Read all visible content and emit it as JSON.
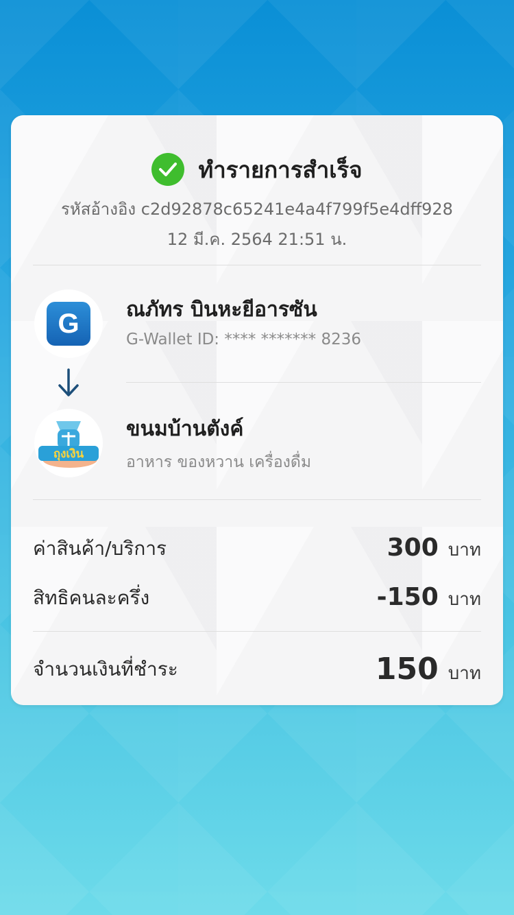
{
  "status": {
    "title": "ทำรายการสำเร็จ",
    "reference": "รหัสอ้างอิง c2d92878c65241e4a4f799f5e4dff928",
    "datetime": "12 มี.ค. 2564 21:51 น."
  },
  "sender": {
    "logo_letter": "G",
    "name": "ณภัทร บินหะยีอารซัน",
    "wallet_id": "G-Wallet ID: **** ******* 8236"
  },
  "receiver": {
    "logo_text": "ถุงเงิน",
    "name": "ขนมบ้านตังค์",
    "category": "อาหาร ของหวาน เครื่องดื่ม"
  },
  "amounts": {
    "goods_label": "ค่าสินค้า/บริการ",
    "goods_value": "300",
    "discount_label": "สิทธิคนละครึ่ง",
    "discount_value": "-150",
    "total_label": "จำนวนเงินที่ชำระ",
    "total_value": "150",
    "unit": "บาท"
  },
  "colors": {
    "success_green": "#3fbd2e",
    "arrow_navy": "#1d4f7a",
    "background_top": "#0a8fd6",
    "background_bottom": "#6ddbea"
  },
  "icons": {
    "status": "check-circle-icon",
    "flow": "arrow-down-icon",
    "sender": "g-wallet-logo",
    "receiver": "thung-ngoen-logo"
  }
}
